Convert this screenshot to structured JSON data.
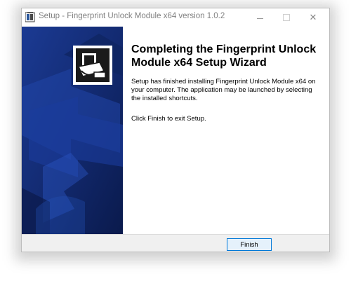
{
  "window": {
    "title": "Setup - Fingerprint Unlock Module x64 version 1.0.2",
    "controls": {
      "minimize_icon": "minimize-icon",
      "maximize_icon": "maximize-icon",
      "close_glyph": "✕"
    }
  },
  "wizard": {
    "heading": "Completing the Fingerprint Unlock Module x64 Setup Wizard",
    "body": "Setup has finished installing Fingerprint Unlock Module x64 on your computer. The application may be launched by selecting the installed shortcuts.",
    "instruction": "Click Finish to exit Setup."
  },
  "buttons": {
    "finish_label": "Finish"
  },
  "colors": {
    "sidebar_dark": "#0c1f5a",
    "sidebar_mid": "#1d3f9b",
    "button_border": "#0078d7",
    "button_bg": "#e5f1fb",
    "footer_bg": "#f0f0f0"
  }
}
